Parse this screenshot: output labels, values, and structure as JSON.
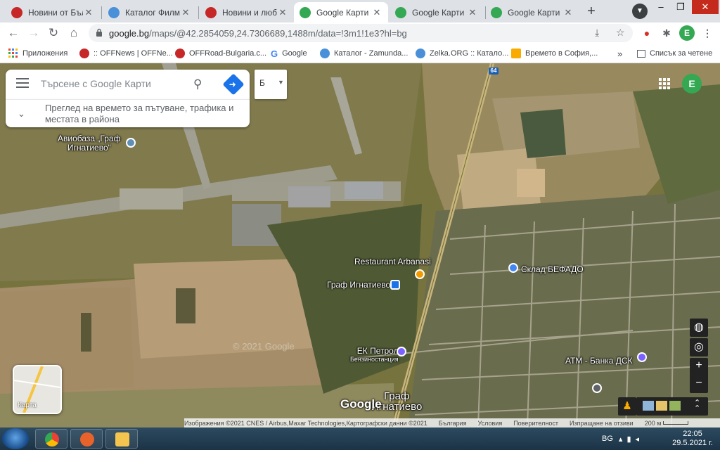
{
  "browser": {
    "tabs": [
      {
        "title": "Новини от Бъл",
        "favicon_color": "#c62828",
        "active": false
      },
      {
        "title": "Каталог Филми",
        "favicon_color": "#4a90d9",
        "active": false
      },
      {
        "title": "Новини и любо",
        "favicon_color": "#c62828",
        "active": false
      },
      {
        "title": "Google Карти",
        "favicon_color": "#34a853",
        "active": true
      },
      {
        "title": "Google Карти",
        "favicon_color": "#34a853",
        "active": false
      },
      {
        "title": "Google Карти",
        "favicon_color": "#34a853",
        "active": false
      }
    ],
    "new_tab_label": "+",
    "window_controls": {
      "minimize": "–",
      "maximize": "❐",
      "close": "✕"
    },
    "url_host": "google.bg",
    "url_path": "/maps/@42.2854059,24.7306689,1488m/data=!3m1!1e3?hl=bg",
    "profile_letter": "E",
    "bookmarks": [
      {
        "label": "Приложения",
        "icon": "apps-grid-icon"
      },
      {
        "label": ":: OFFNews | OFFNe...",
        "icon": "offnews-icon"
      },
      {
        "label": "OFFRoad-Bulgaria.c...",
        "icon": "offroad-icon"
      },
      {
        "label": "Google",
        "icon": "google-icon"
      },
      {
        "label": "Каталог - Zamunda...",
        "icon": "zamunda-icon"
      },
      {
        "label": "Zelka.ORG :: Катало...",
        "icon": "zelka-icon"
      },
      {
        "label": "Времето в София,...",
        "icon": "weather-icon"
      }
    ],
    "bookmarks_overflow": "»",
    "reading_list": "Списък за четене"
  },
  "maps": {
    "search_placeholder": "Търсене с Google Карти",
    "explore_text": "Преглед на времето за пътуване, трафика и местата в района",
    "layer_letter": "Б",
    "road_shield": "64",
    "places": [
      {
        "label": "Авиобаза „Граф Игнатиево“",
        "line1": "Авиобаза „Граф",
        "line2": "Игнатиево“",
        "kind": "landmark",
        "color": "#5f8fb5"
      },
      {
        "label": "Restaurant Arbanasi",
        "kind": "restaurant",
        "color": "#f29900"
      },
      {
        "label": "Граф Игнатиево",
        "kind": "bus-stop",
        "color": "#1a73e8"
      },
      {
        "label": "Склад БЕФАДО",
        "kind": "shop",
        "color": "#4285f4"
      },
      {
        "label": "ЕК Петрол",
        "sublabel": "Бензиностанция",
        "kind": "gas",
        "color": "#7b61ff"
      },
      {
        "label": "АТМ - Банка ДСК",
        "kind": "atm",
        "color": "#7b61ff"
      }
    ],
    "town_label_1": "Граф",
    "town_label_2": "Игнатиево",
    "watermark": "© 2021 Google",
    "google_logo": "Google",
    "minimap_label": "Карта",
    "attribution": {
      "imagery": "Изображения ©2021 CNES / Airbus,Maxar Technologies,Картографски данни ©2021",
      "country": "България",
      "terms": "Условия",
      "privacy": "Поверителност",
      "feedback": "Изпращане на отзиви",
      "scale": "200 м"
    }
  },
  "taskbar": {
    "lang": "BG",
    "time": "22:05",
    "date": "29.5.2021 г."
  }
}
